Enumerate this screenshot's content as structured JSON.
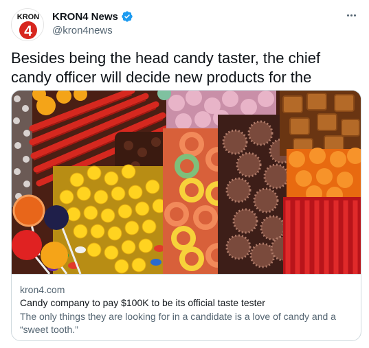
{
  "author": {
    "display_name": "KRON4 News",
    "handle": "@kron4news",
    "avatar_text_top": "KRON",
    "avatar_text_number": "4",
    "verified": true
  },
  "tweet": {
    "text": "Besides being the head candy taster, the chief candy officer will decide new products for the company."
  },
  "card": {
    "domain": "kron4.com",
    "title": "Candy company to pay $100K to be its official taste tester",
    "description": "The only things they are looking for in a candidate is a love of candy and a “sweet tooth.”"
  },
  "colors": {
    "verified_badge": "#1d9bf0",
    "avatar_red": "#d7261e",
    "text_primary": "#0f1419",
    "text_secondary": "#536471",
    "border": "#cfd9de"
  },
  "icons": {
    "verified": "verified-badge-icon",
    "more": "more-options-icon"
  }
}
